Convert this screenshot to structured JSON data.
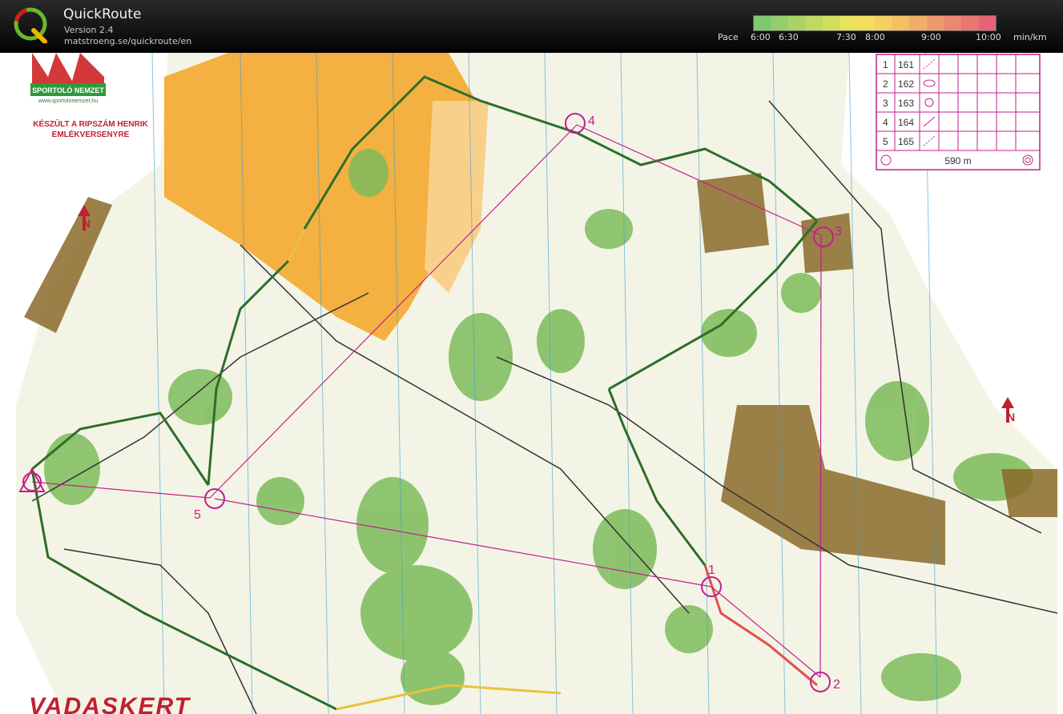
{
  "app": {
    "title": "QuickRoute",
    "version": "Version 2.4",
    "url": "matstroeng.se/quickroute/en"
  },
  "pace": {
    "label": "Pace",
    "unit": "min/km",
    "ticks": [
      "6:00",
      "6:30",
      "7:30",
      "8:00",
      "9:00",
      "10:00"
    ]
  },
  "map": {
    "sponsor_name": "SPORTOLÓ NEMZET",
    "sponsor_url": "www.sportolonemzet.hu",
    "event_line1": "KÉSZÜLT A RIPSZÁM HENRIK",
    "event_line2": "EMLÉKVERSENYRE",
    "place_name": "VADASKERT",
    "north_arrow": "N",
    "controls": [
      "1",
      "2",
      "3",
      "4",
      "5"
    ],
    "control_table": [
      {
        "num": "1",
        "code": "161"
      },
      {
        "num": "2",
        "code": "162"
      },
      {
        "num": "3",
        "code": "163"
      },
      {
        "num": "4",
        "code": "164"
      },
      {
        "num": "5",
        "code": "165"
      }
    ],
    "finish_distance": "590 m"
  },
  "colors": {
    "course": "#c0208c",
    "forest": "#7dbb5a",
    "open": "#f4b040",
    "urban": "#8a6a2a",
    "meridian": "#3aa0d8"
  }
}
